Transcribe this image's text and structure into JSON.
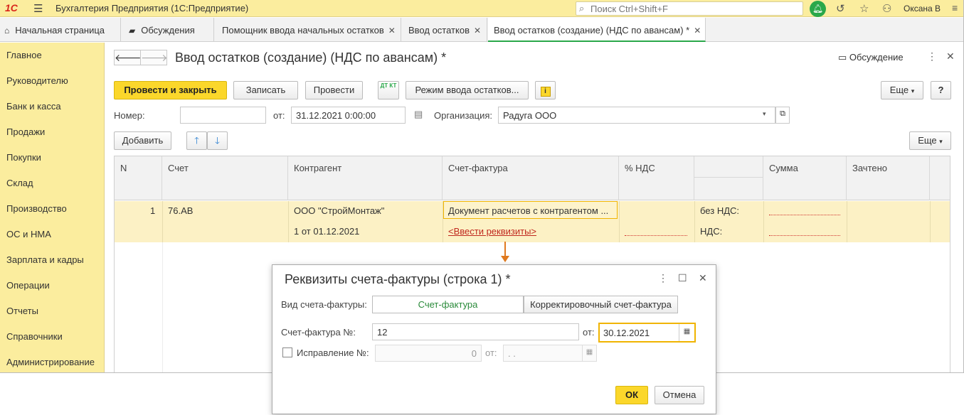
{
  "titlebar": {
    "logo": "1С",
    "app_title": "Бухгалтерия Предприятия  (1С:Предприятие)",
    "search_placeholder": "Поиск Ctrl+Shift+F",
    "user_name": "Оксана В"
  },
  "tabs": [
    {
      "label": "Начальная страница",
      "icon": "home-icon"
    },
    {
      "label": "Обсуждения",
      "icon": "chat-icon"
    },
    {
      "label": "Помощник ввода начальных остатков",
      "close": "✕"
    },
    {
      "label": "Ввод остатков",
      "close": "✕"
    },
    {
      "label": "Ввод остатков (создание) (НДС по авансам) *",
      "close": "✕",
      "active": true
    }
  ],
  "sidebar": {
    "items": [
      "Главное",
      "Руководителю",
      "Банк и касса",
      "Продажи",
      "Покупки",
      "Склад",
      "Производство",
      "ОС и НМА",
      "Зарплата и кадры",
      "Операции",
      "Отчеты",
      "Справочники",
      "Администрирование"
    ]
  },
  "document": {
    "title": "Ввод остатков (создание) (НДС по авансам) *",
    "discussion": "Обсуждение",
    "toolbar": {
      "post_close": "Провести и закрыть",
      "save": "Записать",
      "post": "Провести",
      "dt_kt": "ДТ КТ",
      "mode": "Режим ввода остатков...",
      "info": "i",
      "more": "Еще",
      "help": "?"
    },
    "number_label": "Номер:",
    "number_value": "",
    "date_label": "от:",
    "date_value": "31.12.2021  0:00:00",
    "org_label": "Организация:",
    "org_value": "Радуга ООО",
    "add_label": "Добавить",
    "table_more": "Еще"
  },
  "table": {
    "columns": [
      "N",
      "Счет",
      "Контрагент",
      "Счет-фактура",
      "% НДС",
      "",
      "Сумма",
      "Зачтено"
    ],
    "row": {
      "n": "1",
      "account": "76.АВ",
      "counterparty": "ООО \"СтройМонтаж\"",
      "contract": "1 от 01.12.2021",
      "invoice": "Документ расчетов с контрагентом ...",
      "invoice_link": "<Ввести реквизиты>",
      "without_vat_label": "без НДС:",
      "vat_label": "НДС:"
    }
  },
  "dialog": {
    "title": "Реквизиты счета-фактуры (строка 1) *",
    "kind_label": "Вид счета-фактуры:",
    "kind_options": [
      "Счет-фактура",
      "Корректировочный счет-фактура"
    ],
    "invoice_no_label": "Счет-фактура №:",
    "invoice_no_value": "12",
    "date_label": "от:",
    "date_value": "30.12.2021",
    "correction_label": "Исправление №:",
    "correction_value": "0",
    "correction_date_label": "от:",
    "correction_date_value": " .  .",
    "ok": "ОК",
    "cancel": "Отмена"
  },
  "colors": {
    "accent_yellow": "#fbd72b",
    "sidebar_bg": "#fbed9e",
    "row_highlight": "#fcf1c5",
    "link_red": "#c0281e",
    "arrow_orange": "#e07a1f",
    "active_green": "#2aa84a"
  }
}
